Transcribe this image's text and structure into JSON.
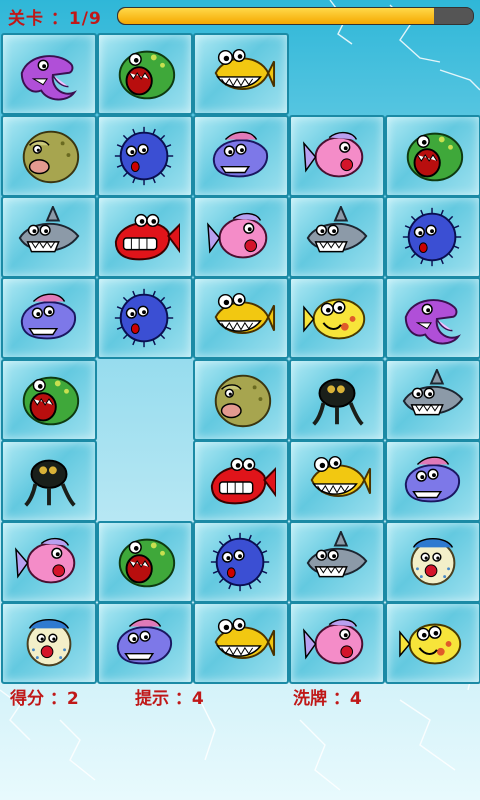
{
  "header": {
    "level_label": "关卡 ：1/9",
    "progress_percent": 89
  },
  "board": {
    "rows": [
      [
        "purple-dolphin",
        "green-fish",
        "yellow-angler",
        null,
        null
      ],
      [
        "olive-fish",
        "blue-puffer",
        "purple-fish",
        "pink-fish",
        "green-fish"
      ],
      [
        "grey-shark",
        "red-piranha",
        "pink-fish",
        "grey-shark",
        "blue-puffer"
      ],
      [
        "purple-fish",
        "blue-puffer",
        "yellow-angler",
        "yellow-fish",
        "purple-dolphin"
      ],
      [
        "green-fish",
        null,
        "olive-fish",
        "black-bug",
        "grey-shark"
      ],
      [
        "black-bug",
        null,
        "red-piranha",
        "yellow-angler",
        "purple-fish"
      ],
      [
        "pink-fish",
        "green-fish",
        "blue-puffer",
        "grey-shark",
        "pufferfish-white"
      ],
      [
        "pufferfish-white",
        "purple-fish",
        "yellow-angler",
        "pink-fish",
        "yellow-fish"
      ]
    ]
  },
  "footer": {
    "score_label": "得分 ：2",
    "hint_label": "提示 ：4",
    "shuffle_label": "洗牌 ：4"
  }
}
